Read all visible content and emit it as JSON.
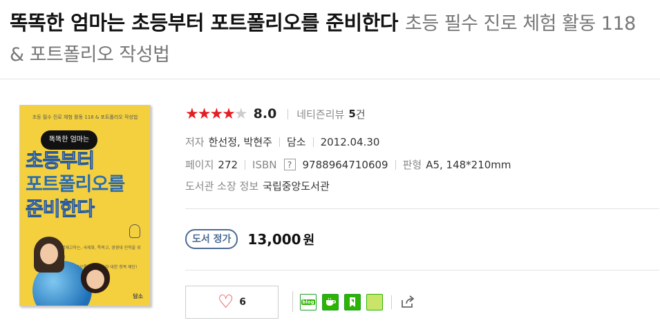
{
  "header": {
    "title": "똑똑한 엄마는 초등부터 포트폴리오를 준비한다",
    "subtitle": "초등 필수 진로 체험 활동 118 & 포트폴리오 작성법"
  },
  "cover": {
    "top_text": "초등 필수 진로 체험 활동 118 & 포트폴리오 작성법",
    "bubble": "똑똑한 엄마는",
    "line1": "초등부터",
    "line2": "포트폴리오를",
    "line3": "준비한다",
    "desc1": "명재고하는, 국제화, 특목고, 경영대 진학을 위해",
    "desc2": "초등 세 공모를 얘기 알아야 대한 청목 제단!",
    "publisher": "담소"
  },
  "rating": {
    "stars_filled": 4,
    "stars_total": 5,
    "filled_glyph": "★★★★",
    "empty_glyph": "★",
    "score": "8.0",
    "review_label": "네티즌리뷰",
    "review_count": "5",
    "review_unit": "건"
  },
  "details": {
    "author_label": "저자",
    "authors": "한선정, 박현주",
    "publisher": "담소",
    "date": "2012.04.30",
    "pages_label": "페이지",
    "pages": "272",
    "isbn_label": "ISBN",
    "isbn_help": "?",
    "isbn": "9788964710609",
    "format_label": "판형",
    "format": "A5, 148*210mm",
    "library_label": "도서관 소장 정보",
    "library": "국립중앙도서관"
  },
  "price": {
    "badge": "도서 정가",
    "value": "13,000",
    "unit": "원"
  },
  "like": {
    "icon": "heart-icon",
    "count": "6"
  },
  "share": {
    "blog_label": "blog",
    "icons": [
      "blog-icon",
      "cafe-icon",
      "bookmark-icon",
      "memo-icon",
      "share-out-icon"
    ]
  },
  "colors": {
    "accent_red": "#e31e24",
    "badge_blue": "#4a6a93",
    "naver_green": "#2db400",
    "cover_yellow": "#f4d03f"
  }
}
